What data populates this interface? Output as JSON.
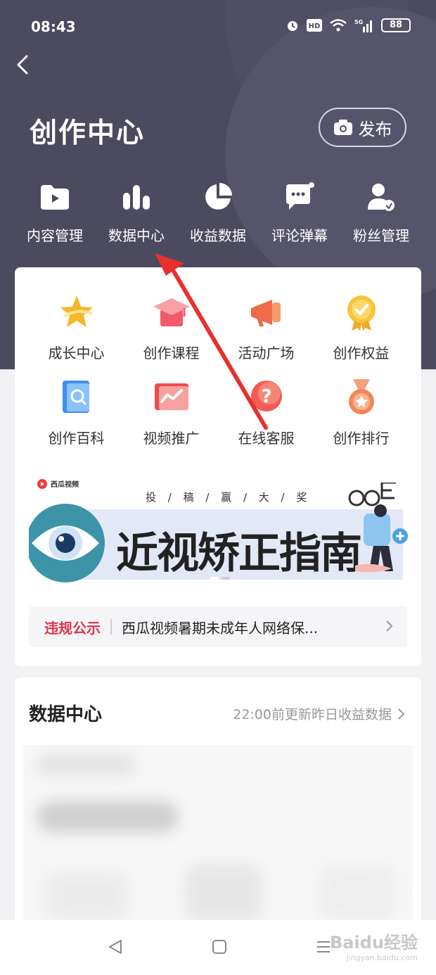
{
  "status": {
    "time": "08:43",
    "battery": "88",
    "hd": "HD",
    "network": "5G"
  },
  "header": {
    "title": "创作中心",
    "publish_label": "发布"
  },
  "toolbar": [
    {
      "label": "内容管理",
      "icon": "video-folder-icon"
    },
    {
      "label": "数据中心",
      "icon": "bar-chart-icon"
    },
    {
      "label": "收益数据",
      "icon": "pie-chart-icon"
    },
    {
      "label": "评论弹幕",
      "icon": "comment-icon"
    },
    {
      "label": "粉丝管理",
      "icon": "fan-user-icon"
    }
  ],
  "grid": [
    {
      "label": "成长中心",
      "icon": "star-icon"
    },
    {
      "label": "创作课程",
      "icon": "graduation-cap-icon"
    },
    {
      "label": "活动广场",
      "icon": "megaphone-icon"
    },
    {
      "label": "创作权益",
      "icon": "medal-check-icon"
    },
    {
      "label": "创作百科",
      "icon": "book-search-icon"
    },
    {
      "label": "视频推广",
      "icon": "trend-chart-icon"
    },
    {
      "label": "在线客服",
      "icon": "help-icon"
    },
    {
      "label": "创作排行",
      "icon": "ranking-medal-icon"
    }
  ],
  "banner": {
    "brand": "西瓜视频",
    "subtitle": "投 / 稿 / 赢 / 大 / 奖",
    "headline": "近视矫正指南"
  },
  "notice": {
    "tag": "违规公示",
    "text": "西瓜视频暑期未成年人网络保..."
  },
  "data_center": {
    "title": "数据中心",
    "note": "22:00前更新昨日收益数据"
  },
  "watermark": {
    "main": "Baidu经验",
    "sub": "jingyan.baidu.com"
  },
  "colors": {
    "hero": "#4b4a5e",
    "accent_red": "#e0344f",
    "annotation_arrow": "#e8302e"
  }
}
